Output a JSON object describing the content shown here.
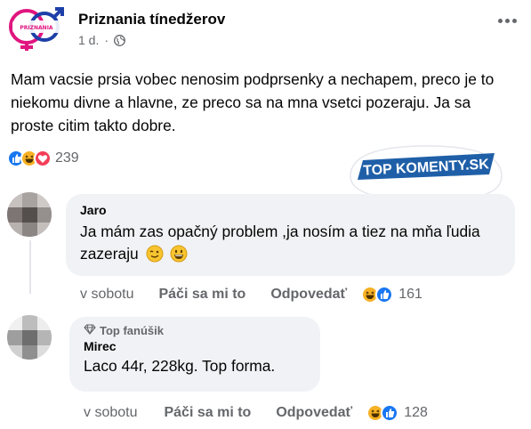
{
  "post": {
    "page_name": "Priznania tínedžerov",
    "logo_text": "PRIZNANIA TÍNEDŽEROV",
    "time": "1 d.",
    "separator": "·",
    "privacy_icon": "globe-icon",
    "text": "Mam vacsie prsia vobec nenosim podprsenky a nechapem, preco je to niekomu divne a hlavne, ze preco sa na mna vsetci pozeraju. Ja sa proste citim takto dobre.",
    "reactions": {
      "icons": [
        "like",
        "haha",
        "love"
      ],
      "count": "239"
    }
  },
  "watermark": {
    "text": "TOP KOMENTY.SK"
  },
  "comments": [
    {
      "author": "Jaro",
      "text": "Ja mám zas opačný problem ,ja nosím a tiez na mňa ľudia zazeraju",
      "emojis": [
        "wink-emoji",
        "grin-emoji"
      ],
      "time": "v sobotu",
      "like_label": "Páči sa mi to",
      "reply_label": "Odpovedať",
      "reactions": {
        "icons": [
          "haha",
          "like"
        ],
        "count": "161"
      }
    },
    {
      "badge": "Top fanúšik",
      "author": "Mirec",
      "text": "Laco 44r, 228kg. Top forma.",
      "time": "v sobotu",
      "like_label": "Páči sa mi to",
      "reply_label": "Odpovedať",
      "reactions": {
        "icons": [
          "haha",
          "like"
        ],
        "count": "128"
      }
    }
  ],
  "colors": {
    "secondary_text": "#65676b",
    "bubble": "#f0f2f5",
    "like_blue": "#1877f2",
    "love_red": "#f33e58",
    "haha_yellow": "#f7b125",
    "logo_pink": "#e0157f",
    "logo_blue": "#1d3fa8",
    "watermark_blue": "#1f5fa8"
  }
}
